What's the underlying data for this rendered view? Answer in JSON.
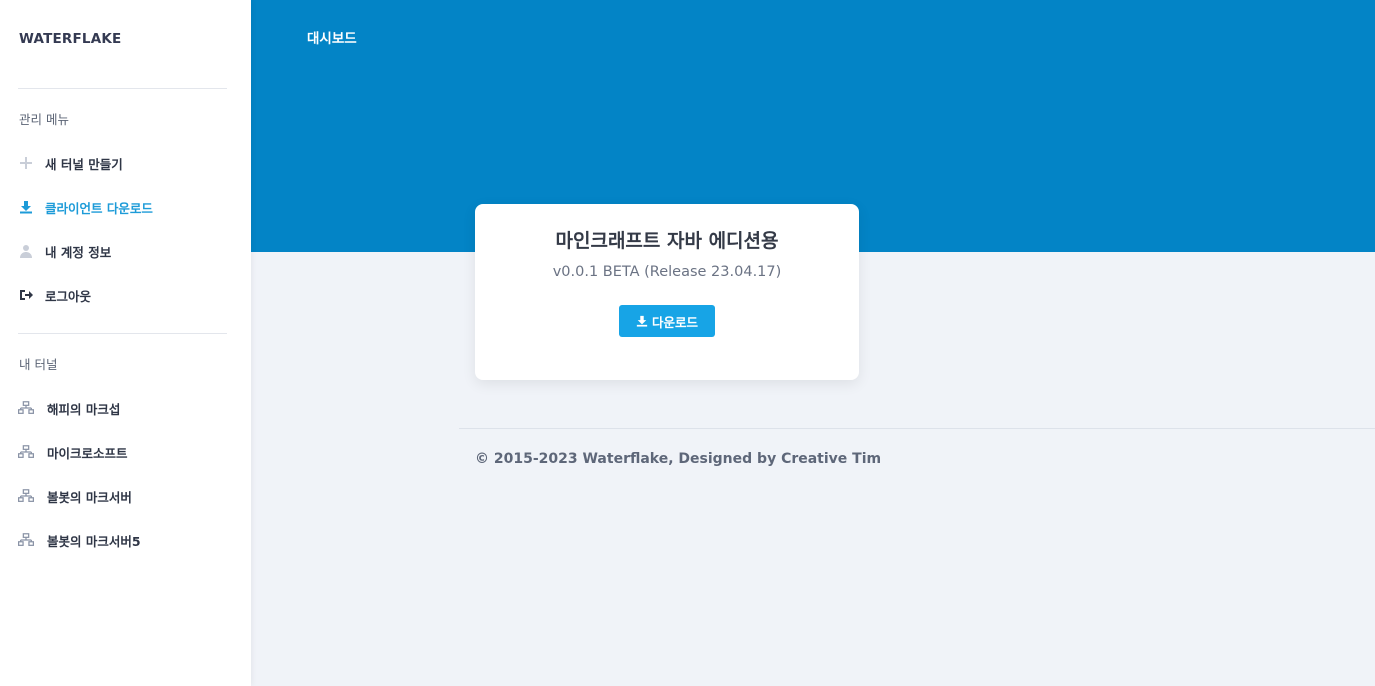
{
  "sidebar": {
    "brand": "WATERFLAKE",
    "menu_title": "관리 메뉴",
    "menu_items": [
      {
        "label": "새 터널 만들기",
        "icon": "plus-icon"
      },
      {
        "label": "클라이언트 다운로드",
        "icon": "download-icon",
        "active": true
      },
      {
        "label": "내 계정 정보",
        "icon": "user-icon"
      },
      {
        "label": "로그아웃",
        "icon": "logout-icon"
      }
    ],
    "tunnels_title": "내 터널",
    "tunnels": [
      {
        "label": "해피의 마크섭",
        "icon": "network-icon"
      },
      {
        "label": "마이크로소프트",
        "icon": "network-icon"
      },
      {
        "label": "볼봇의 마크서버",
        "icon": "network-icon"
      },
      {
        "label": "볼봇의 마크서버5",
        "icon": "network-icon"
      }
    ]
  },
  "header": {
    "title": "대시보드"
  },
  "card": {
    "title": "마인크래프트 자바 에디션용",
    "version": "v0.0.1 BETA (Release 23.04.17)",
    "button_label": "다운로드"
  },
  "footer": {
    "text": "© 2015-2023 Waterflake, Designed by Creative Tim"
  },
  "colors": {
    "header_bg": "#0384c6",
    "accent": "#17a4e6",
    "active_nav": "#1d9bd8"
  }
}
